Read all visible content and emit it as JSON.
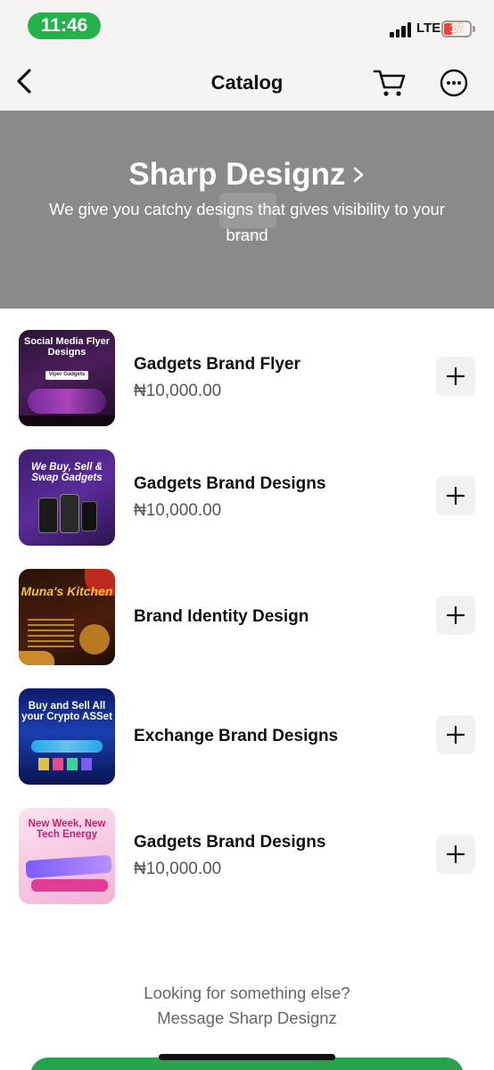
{
  "status_bar": {
    "time": "11:46",
    "network": "LTE",
    "battery": "17",
    "signal_bars": 4,
    "battery_level_percent": 17
  },
  "nav": {
    "title": "Catalog",
    "back_icon": "chevron-left-icon",
    "cart_icon": "shopping-cart-icon",
    "more_icon": "more-horizontal-circle-icon"
  },
  "banner": {
    "title": "Sharp Designz",
    "subtitle": "We give you catchy designs that gives visibility to your brand",
    "background_color": "#8a8a8a"
  },
  "products": [
    {
      "name": "Gadgets Brand Flyer",
      "price": "₦10,000.00",
      "thumb_text": "Social Media Flyer Designs",
      "thumb_sub": "Viper Gadgets"
    },
    {
      "name": "Gadgets Brand Designs",
      "price": "₦10,000.00",
      "thumb_text": "We Buy, Sell & Swap Gadgets",
      "thumb_sub": ""
    },
    {
      "name": "Brand Identity Design",
      "price": "",
      "thumb_text": "Muna's Kitchen",
      "thumb_sub": ""
    },
    {
      "name": "Exchange Brand Designs",
      "price": "",
      "thumb_text": "Buy and Sell All your Crypto ASSet",
      "thumb_sub": ""
    },
    {
      "name": "Gadgets Brand Designs",
      "price": "₦10,000.00",
      "thumb_text": "New Week, New Tech Energy",
      "thumb_sub": ""
    }
  ],
  "footer": {
    "question": "Looking for something else?",
    "message_link": "Message Sharp Designz"
  },
  "colors": {
    "accent_green": "#25a44c",
    "time_pill_green": "#24b24b",
    "battery_low_red": "#e5443a"
  }
}
